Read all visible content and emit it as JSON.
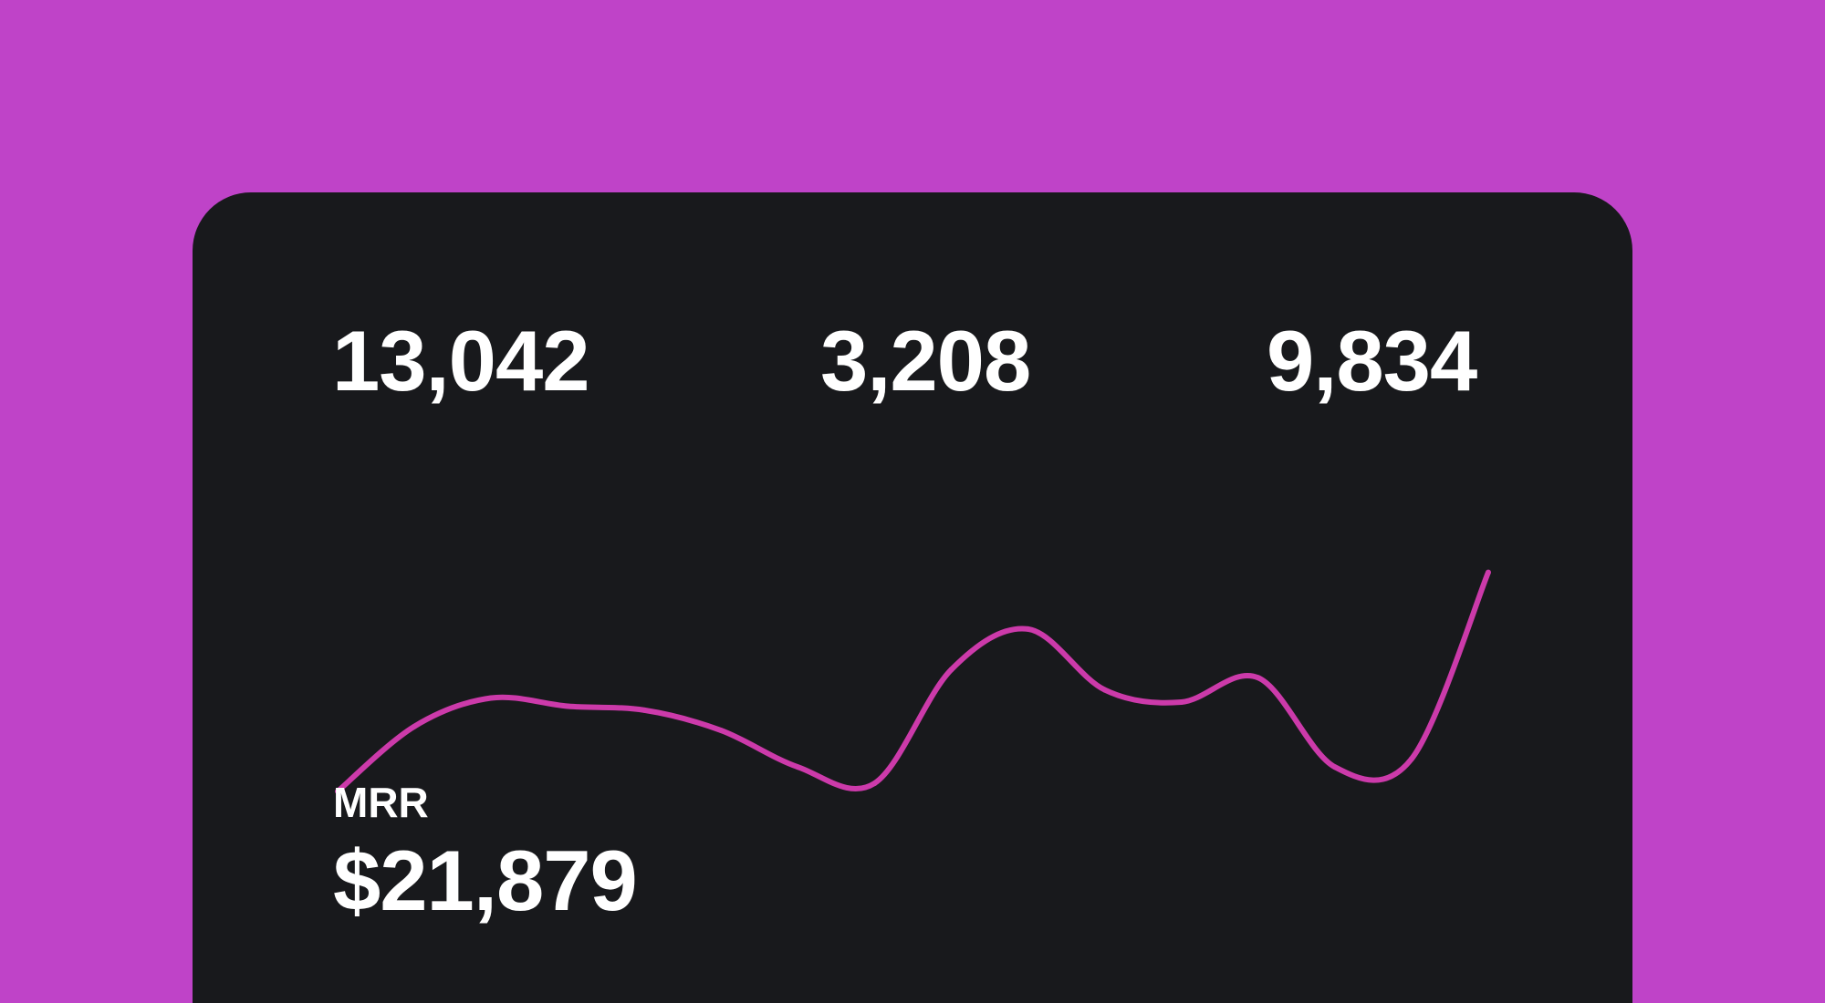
{
  "theme": {
    "background": "#bf43c8",
    "card": "#18191c",
    "text": "#ffffff",
    "line": "#cc3aaa"
  },
  "stats": [
    {
      "value": "13,042"
    },
    {
      "value": "3,208"
    },
    {
      "value": "9,834"
    }
  ],
  "mrr": {
    "label": "MRR",
    "value": "$21,879"
  },
  "chart_data": {
    "type": "line",
    "series": [
      {
        "values": [
          0.18,
          0.34,
          0.41,
          0.39,
          0.38,
          0.33,
          0.24,
          0.2,
          0.48,
          0.58,
          0.43,
          0.4,
          0.46,
          0.24,
          0.26,
          0.72
        ]
      }
    ],
    "axes_visible": false,
    "grid": false
  }
}
